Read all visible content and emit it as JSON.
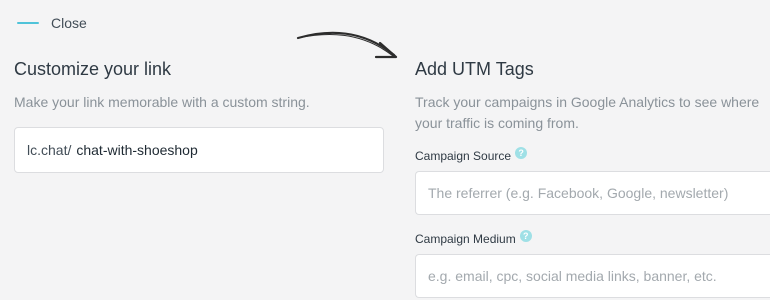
{
  "close": {
    "label": "Close"
  },
  "customize": {
    "title": "Customize your link",
    "subtitle": "Make your link memorable with a custom string.",
    "prefix": "lc.chat/",
    "value": "chat-with-shoeshop"
  },
  "utm": {
    "title": "Add UTM Tags",
    "subtitle": "Track your campaigns in Google Analytics to see where your traffic is coming from.",
    "fields": [
      {
        "label": "Campaign Source",
        "help_icon": "question-icon",
        "placeholder": "The referrer (e.g. Facebook, Google, newsletter)"
      },
      {
        "label": "Campaign Medium",
        "help_icon": "question-icon",
        "placeholder": "e.g. email, cpc, social media links, banner, etc."
      }
    ]
  },
  "colors": {
    "accent": "#4fc3d9",
    "help": "#9fe0e6"
  }
}
